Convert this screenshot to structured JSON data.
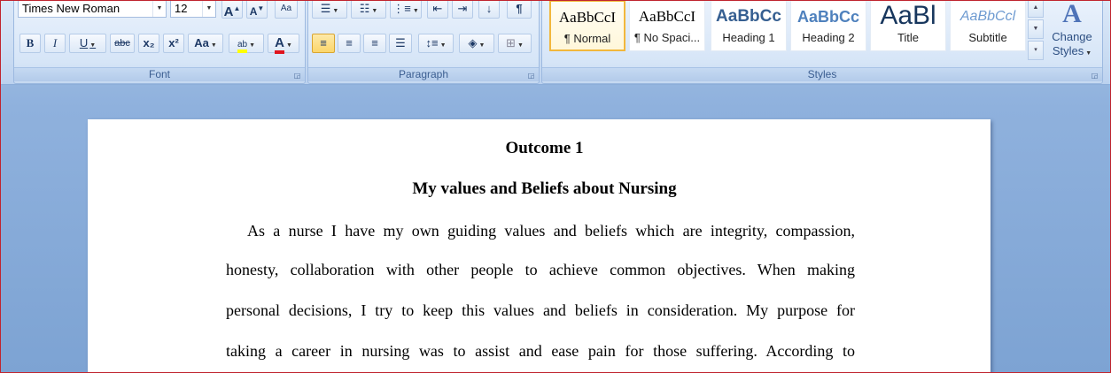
{
  "ribbon": {
    "font": {
      "label": "Font",
      "font_name": "Times New Roman",
      "font_size": "12",
      "grow_glyph": "A",
      "shrink_glyph": "A",
      "clear_glyph": "Aa",
      "bold": "B",
      "italic": "I",
      "underline": "U",
      "strike": "abc",
      "subscript": "x₂",
      "superscript": "x²",
      "change_case": "Aa",
      "highlight_glyph": "ab",
      "font_color_glyph": "A",
      "highlight_color": "#ffff00",
      "font_color": "#e0141e"
    },
    "paragraph": {
      "label": "Paragraph"
    },
    "styles": {
      "label": "Styles",
      "items": [
        {
          "sample": "AaBbCcI",
          "name": "¶ Normal"
        },
        {
          "sample": "AaBbCcI",
          "name": "¶ No Spaci..."
        },
        {
          "sample": "AaBbCc",
          "name": "Heading 1"
        },
        {
          "sample": "AaBbCc",
          "name": "Heading 2"
        },
        {
          "sample": "AaBl",
          "name": "Title"
        },
        {
          "sample": "AaBbCcl",
          "name": "Subtitle"
        }
      ],
      "change_styles_line1": "Change",
      "change_styles_line2": "Styles"
    }
  },
  "document": {
    "heading1": "Outcome 1",
    "heading2": "My values and Beliefs about Nursing",
    "lines": [
      "As a nurse I have my own guiding values and beliefs which are integrity, compassion,",
      "honesty, collaboration with other people to achieve common objectives. When making",
      "personal decisions, I try to keep this values and beliefs in consideration. My purpose for",
      "taking a career in nursing was to assist and ease pain for those suffering. According to"
    ]
  },
  "colors": {
    "accent": "#f2b73c",
    "ribbon_text": "#3b5e91",
    "heading1_style": "#365f91",
    "heading2_style": "#4f81bd"
  }
}
